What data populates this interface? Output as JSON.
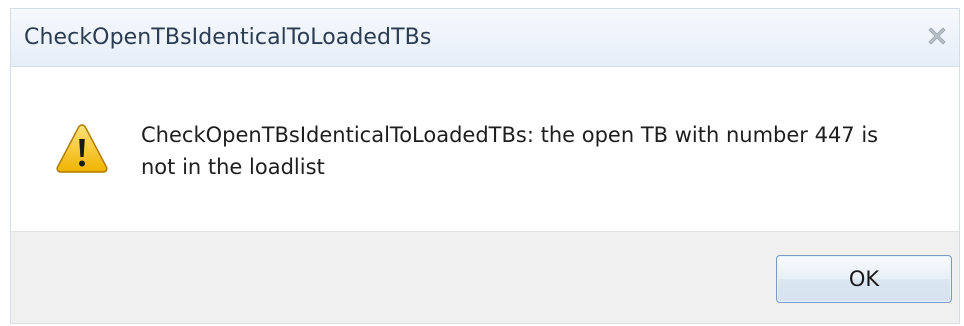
{
  "dialog": {
    "title": "CheckOpenTBsIdenticalToLoadedTBs",
    "message_line1": "CheckOpenTBsIdenticalToLoadedTBs:  the open TB with number 447 is",
    "message_line2": "not in the loadlist",
    "icon": "warning-icon",
    "close_icon": "close-icon",
    "ok_label": "OK"
  },
  "colors": {
    "title_bar": "#e6eef8",
    "footer": "#f0f0f0",
    "warning_fill": "#f3c200",
    "button_border": "#7a9cc4"
  }
}
